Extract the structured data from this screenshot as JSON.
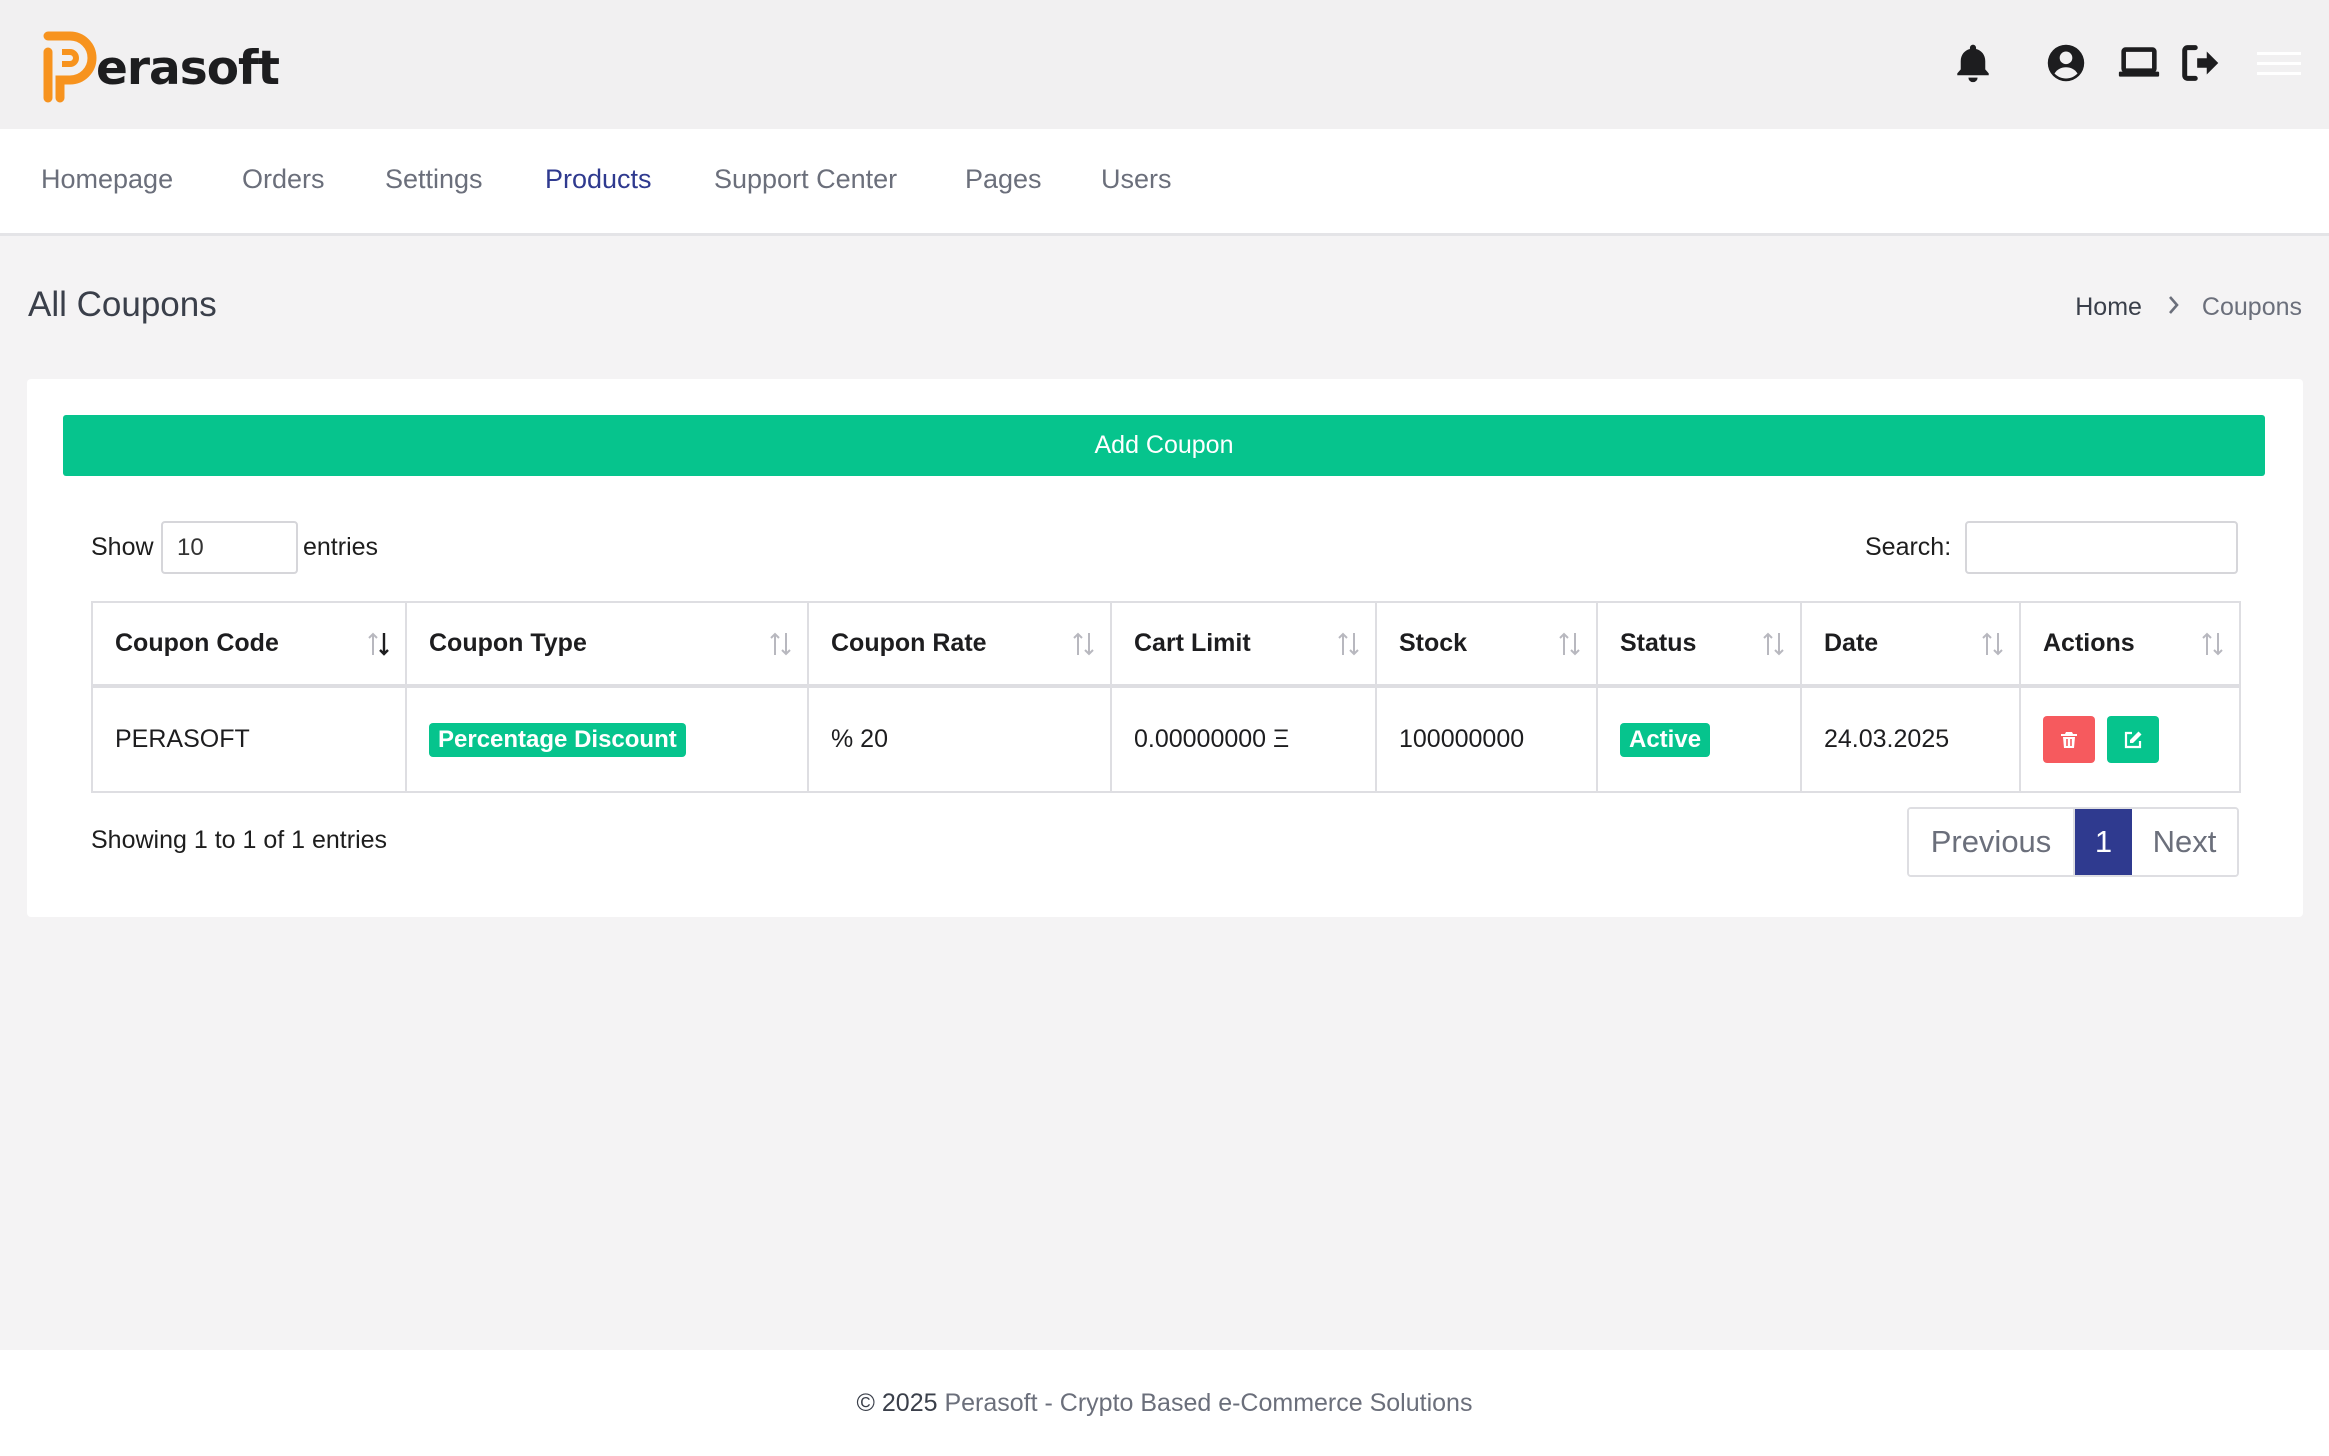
{
  "brand": {
    "name": "erasoft",
    "accent": "#f7931e"
  },
  "header": {
    "icons": [
      "bell-icon",
      "user-circle-icon",
      "laptop-icon",
      "sign-out-icon",
      "hamburger-menu-icon"
    ]
  },
  "nav": {
    "items": [
      {
        "label": "Homepage",
        "active": false
      },
      {
        "label": "Orders",
        "active": false
      },
      {
        "label": "Settings",
        "active": false
      },
      {
        "label": "Products",
        "active": true
      },
      {
        "label": "Support Center",
        "active": false
      },
      {
        "label": "Pages",
        "active": false
      },
      {
        "label": "Users",
        "active": false
      }
    ]
  },
  "page": {
    "title": "All Coupons",
    "breadcrumb": {
      "home": "Home",
      "current": "Coupons"
    }
  },
  "card": {
    "add_button": "Add Coupon",
    "length": {
      "show": "Show",
      "value": "10",
      "entries": "entries"
    },
    "search": {
      "label": "Search:",
      "value": ""
    },
    "table": {
      "columns": [
        "Coupon Code",
        "Coupon Type",
        "Coupon Rate",
        "Cart Limit",
        "Stock",
        "Status",
        "Date",
        "Actions"
      ],
      "rows": [
        {
          "code": "PERASOFT",
          "type": "Percentage Discount",
          "rate": "% 20",
          "cart_limit": "0.00000000 Ξ",
          "stock": "100000000",
          "status": "Active",
          "date": "24.03.2025"
        }
      ]
    },
    "info": "Showing 1 to 1 of 1 entries",
    "pagination": {
      "previous": "Previous",
      "current": "1",
      "next": "Next"
    }
  },
  "footer": {
    "copyright": "© 2025",
    "text": " Perasoft - Crypto Based e-Commerce Solutions"
  },
  "colors": {
    "primary": "#2f3a8f",
    "success": "#06c48d",
    "danger": "#f65a5e"
  }
}
